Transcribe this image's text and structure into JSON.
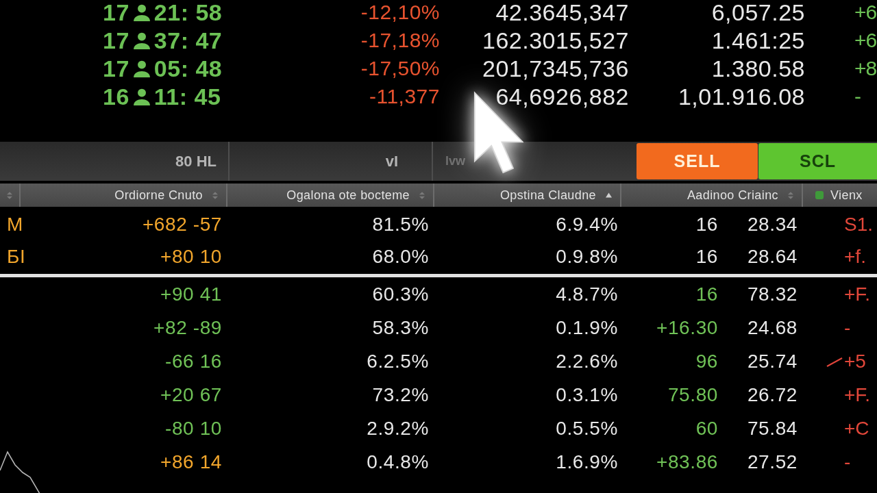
{
  "ticker": [
    {
      "hour": "17",
      "clock": "21: 58",
      "change": "-12,10%",
      "volume": "42.3645,347",
      "price": "6,057.25",
      "delta": "+6"
    },
    {
      "hour": "17",
      "clock": "37: 47",
      "change": "-17,18%",
      "volume": "162.3015,527",
      "price": "1.461:25",
      "delta": "+6"
    },
    {
      "hour": "17",
      "clock": "05: 48",
      "change": "-17,50%",
      "volume": "201,7345,736",
      "price": "1.380.58",
      "delta": "+8"
    },
    {
      "hour": "16",
      "clock": "11: 45",
      "change": "-11,377",
      "volume": "64,6926,882",
      "price": "1,01.916.08",
      "delta": "-"
    }
  ],
  "toolbar": {
    "labels": [
      "80 HL",
      "vI",
      "lvw"
    ],
    "buttons": [
      {
        "label": "SELL",
        "kind": "warning"
      },
      {
        "label": "SCL",
        "kind": "success"
      }
    ]
  },
  "table": {
    "columns": [
      {
        "label": "Ordiorne Cnuto",
        "kind": "sortable",
        "sorted": false
      },
      {
        "label": "Ogalona ote bocteme",
        "kind": "sortable",
        "sorted": false
      },
      {
        "label": "Opstina Claudne",
        "kind": "sortable",
        "sorted": true
      },
      {
        "kind": "blank"
      },
      {
        "label": "Aadinoo Criainc",
        "kind": "sortable",
        "sorted": false
      },
      {
        "label": "Vienx",
        "kind": "flagged",
        "sorted": false
      }
    ],
    "pinned_rows": [
      {
        "symbol": {
          "text": "M",
          "color": "#f2a62c"
        },
        "trend": false,
        "cells": [
          {
            "text": "+682 -57",
            "color": "#f2a62c"
          },
          {
            "text": "81.5%",
            "color": "#e8e8e8"
          },
          {
            "text": "6.9.4%",
            "color": "#e8e8e8"
          },
          {
            "text": "16",
            "color": "#e8e8e8"
          },
          {
            "text": "28.34",
            "color": "#e8e8e8"
          },
          {
            "text": "S1.",
            "color": "#e2473a"
          }
        ]
      },
      {
        "symbol": {
          "text": "БI",
          "color": "#f2a62c"
        },
        "trend": false,
        "cells": [
          {
            "text": "+80 10",
            "color": "#f2a62c"
          },
          {
            "text": "68.0%",
            "color": "#e8e8e8"
          },
          {
            "text": "0.9.8%",
            "color": "#e8e8e8"
          },
          {
            "text": "16",
            "color": "#e8e8e8"
          },
          {
            "text": "28.64",
            "color": "#e8e8e8"
          },
          {
            "text": "+f.",
            "color": "#e2473a"
          }
        ]
      }
    ],
    "rows": [
      {
        "trend": false,
        "cells": [
          {
            "text": "+90 41",
            "color": "#70c257"
          },
          {
            "text": "60.3%",
            "color": "#e8e8e8"
          },
          {
            "text": "4.8.7%",
            "color": "#e8e8e8"
          },
          {
            "text": "16",
            "color": "#70c257"
          },
          {
            "text": "78.32",
            "color": "#e8e8e8"
          },
          {
            "text": "+F.",
            "color": "#e2473a"
          }
        ]
      },
      {
        "trend": false,
        "cells": [
          {
            "text": "+82 -89",
            "color": "#70c257"
          },
          {
            "text": "58.3%",
            "color": "#e8e8e8"
          },
          {
            "text": "0.1.9%",
            "color": "#e8e8e8"
          },
          {
            "text": "+16.30",
            "color": "#70c257"
          },
          {
            "text": "24.68",
            "color": "#e8e8e8"
          },
          {
            "text": "-",
            "color": "#e2473a"
          }
        ]
      },
      {
        "trend": true,
        "cells": [
          {
            "text": "-66 16",
            "color": "#70c257"
          },
          {
            "text": "6.2.5%",
            "color": "#e8e8e8"
          },
          {
            "text": "2.2.6%",
            "color": "#e8e8e8"
          },
          {
            "text": "96",
            "color": "#70c257"
          },
          {
            "text": "25.74",
            "color": "#e8e8e8"
          },
          {
            "text": "+5",
            "color": "#e2473a"
          }
        ]
      },
      {
        "trend": false,
        "cells": [
          {
            "text": "+20 67",
            "color": "#70c257"
          },
          {
            "text": "73.2%",
            "color": "#e8e8e8"
          },
          {
            "text": "0.3.1%",
            "color": "#e8e8e8"
          },
          {
            "text": "75.80",
            "color": "#70c257"
          },
          {
            "text": "26.72",
            "color": "#e8e8e8"
          },
          {
            "text": "+F.",
            "color": "#e2473a"
          }
        ]
      },
      {
        "trend": false,
        "cells": [
          {
            "text": "-80 10",
            "color": "#70c257"
          },
          {
            "text": "2.9.2%",
            "color": "#e8e8e8"
          },
          {
            "text": "0.5.5%",
            "color": "#e8e8e8"
          },
          {
            "text": "60",
            "color": "#70c257"
          },
          {
            "text": "75.84",
            "color": "#e8e8e8"
          },
          {
            "text": "+C",
            "color": "#e2473a"
          }
        ]
      },
      {
        "trend": false,
        "cells": [
          {
            "text": "+86 14",
            "color": "#f2a62c"
          },
          {
            "text": "0.4.8%",
            "color": "#e8e8e8"
          },
          {
            "text": "1.6.9%",
            "color": "#e8e8e8"
          },
          {
            "text": "+83.86",
            "color": "#70c257"
          },
          {
            "text": "27.52",
            "color": "#e8e8e8"
          },
          {
            "text": "-",
            "color": "#e2473a"
          }
        ]
      }
    ]
  }
}
